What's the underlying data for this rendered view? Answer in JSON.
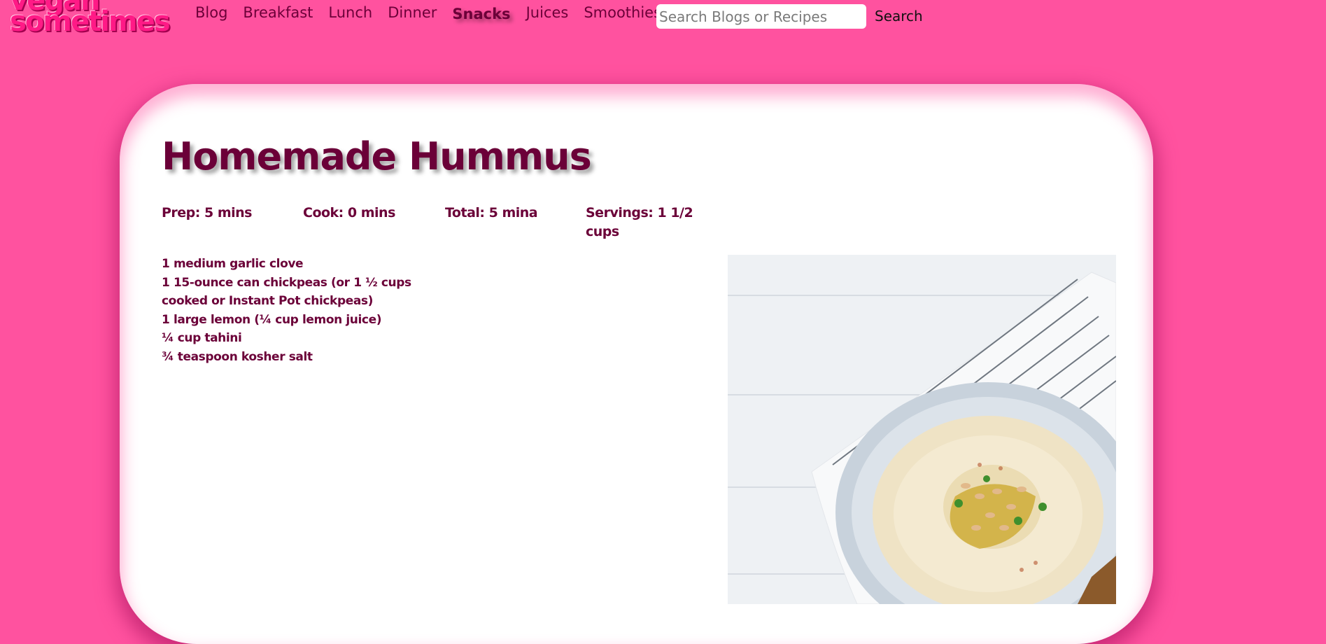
{
  "site": {
    "logo_line1": "vegan",
    "logo_line2": "sometimes"
  },
  "nav": {
    "items": [
      {
        "label": "Blog"
      },
      {
        "label": "Breakfast"
      },
      {
        "label": "Lunch"
      },
      {
        "label": "Dinner"
      },
      {
        "label": "Snacks",
        "active": true
      },
      {
        "label": "Juices"
      },
      {
        "label": "Smoothies"
      }
    ]
  },
  "search": {
    "placeholder": "Search Blogs or Recipes",
    "value": "",
    "button_label": "Search"
  },
  "recipe": {
    "title": "Homemade Hummus",
    "prep": "Prep: 5 mins",
    "cook": "Cook: 0 mins",
    "total": "Total: 5 mina",
    "servings": "Servings: 1 1/2 cups",
    "ingredients": [
      "1 medium garlic clove",
      "1 15-ounce can chickpeas (or 1 ½ cups cooked or Instant Pot chickpeas)",
      "1 large lemon (¼ cup lemon juice)",
      "¼ cup tahini",
      "¾ teaspoon kosher salt"
    ]
  },
  "colors": {
    "background": "#ff529f",
    "accent_text": "#6b0038",
    "logo": "#ff1a86",
    "card": "#ffffff"
  }
}
